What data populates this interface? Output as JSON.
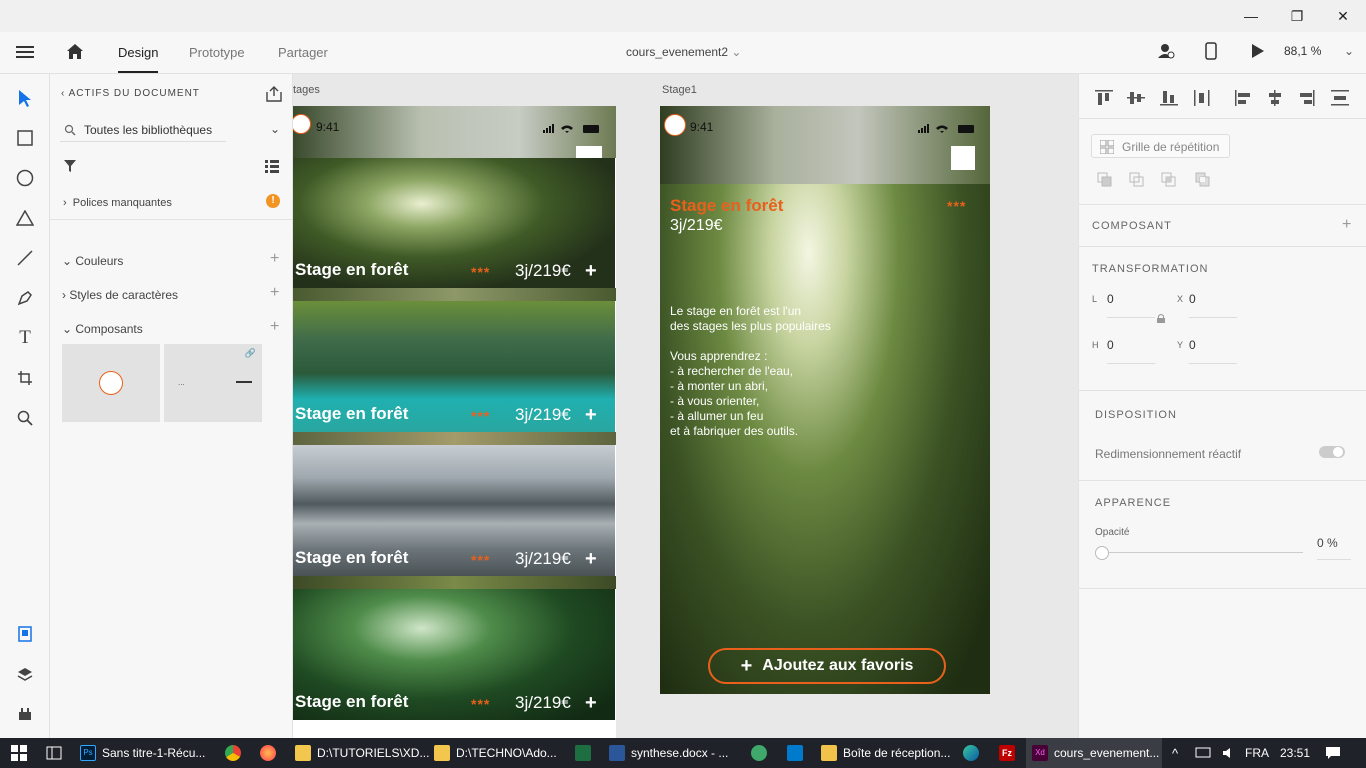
{
  "window": {
    "minimize": "—",
    "maximize": "❐",
    "close": "✕"
  },
  "menu": {
    "tabs": [
      "Design",
      "Prototype",
      "Partager"
    ],
    "doc_title": "cours_evenement2",
    "zoom": "88,1 %"
  },
  "assets": {
    "header": "ACTIFS DU DOCUMENT",
    "library": "Toutes les bibliothèques",
    "missing_fonts": "Polices manquantes",
    "sections": [
      "Couleurs",
      "Styles de caractères",
      "Composants"
    ]
  },
  "canvas": {
    "artboard_left_label": "tages",
    "artboard_right_label": "Stage1",
    "status_time": "9:41",
    "card_title": "Stage en forêt",
    "card_stars": "***",
    "card_price": "3j/219€",
    "card_plus": "+",
    "detail_title": "Stage en forêt",
    "detail_price": "3j/219€",
    "detail_stars": "***",
    "detail_body": [
      "Le stage en forêt est l'un",
      "des stages les plus populaires",
      "",
      "Vous apprendrez :",
      "- à rechercher de l'eau,",
      "- à monter un abri,",
      "- à vous orienter,",
      "- à allumer un feu",
      "et à fabriquer des outils."
    ],
    "fav_button": "AJoutez aux favoris"
  },
  "props": {
    "repeat_grid": "Grille de répétition",
    "component": "COMPOSANT",
    "transform": "TRANSFORMATION",
    "w_label": "L",
    "w_val": "0",
    "h_label": "H",
    "h_val": "0",
    "x_label": "X",
    "x_val": "0",
    "y_label": "Y",
    "y_val": "0",
    "disposition": "DISPOSITION",
    "responsive": "Redimensionnement réactif",
    "appearance": "APPARENCE",
    "opacity_label": "Opacité",
    "opacity_val": "0 %"
  },
  "taskbar": {
    "items": [
      "Sans titre-1-Récu...",
      "D:\\TUTORIELS\\XD...",
      "D:\\TECHNO\\Ado...",
      "synthese.docx - ...",
      "Boîte de réception...",
      "cours_evenement..."
    ],
    "lang": "FRA",
    "time": "23:51"
  },
  "colors": {
    "accent": "#e8601c",
    "xd": "#2b1a2f"
  }
}
